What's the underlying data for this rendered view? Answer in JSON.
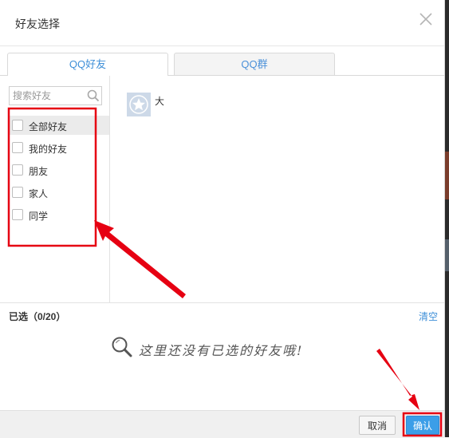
{
  "dialog": {
    "title": "好友选择"
  },
  "tabs": [
    {
      "label": "QQ好友",
      "active": true
    },
    {
      "label": "QQ群",
      "active": false
    }
  ],
  "search": {
    "placeholder": "搜索好友"
  },
  "groups": [
    {
      "label": "全部好友"
    },
    {
      "label": "我的好友"
    },
    {
      "label": "朋友"
    },
    {
      "label": "家人"
    },
    {
      "label": "同学"
    }
  ],
  "friends": [
    {
      "name": "大"
    }
  ],
  "selected": {
    "label": "已选（0/20）",
    "clear_label": "清空",
    "empty_hint": "这里还没有已选的好友哦!"
  },
  "footer": {
    "cancel_label": "取消",
    "confirm_label": "确认"
  },
  "colors": {
    "accent": "#3e8fd8",
    "confirm_button": "#3b9ee8",
    "annotation_red": "#e60012"
  }
}
